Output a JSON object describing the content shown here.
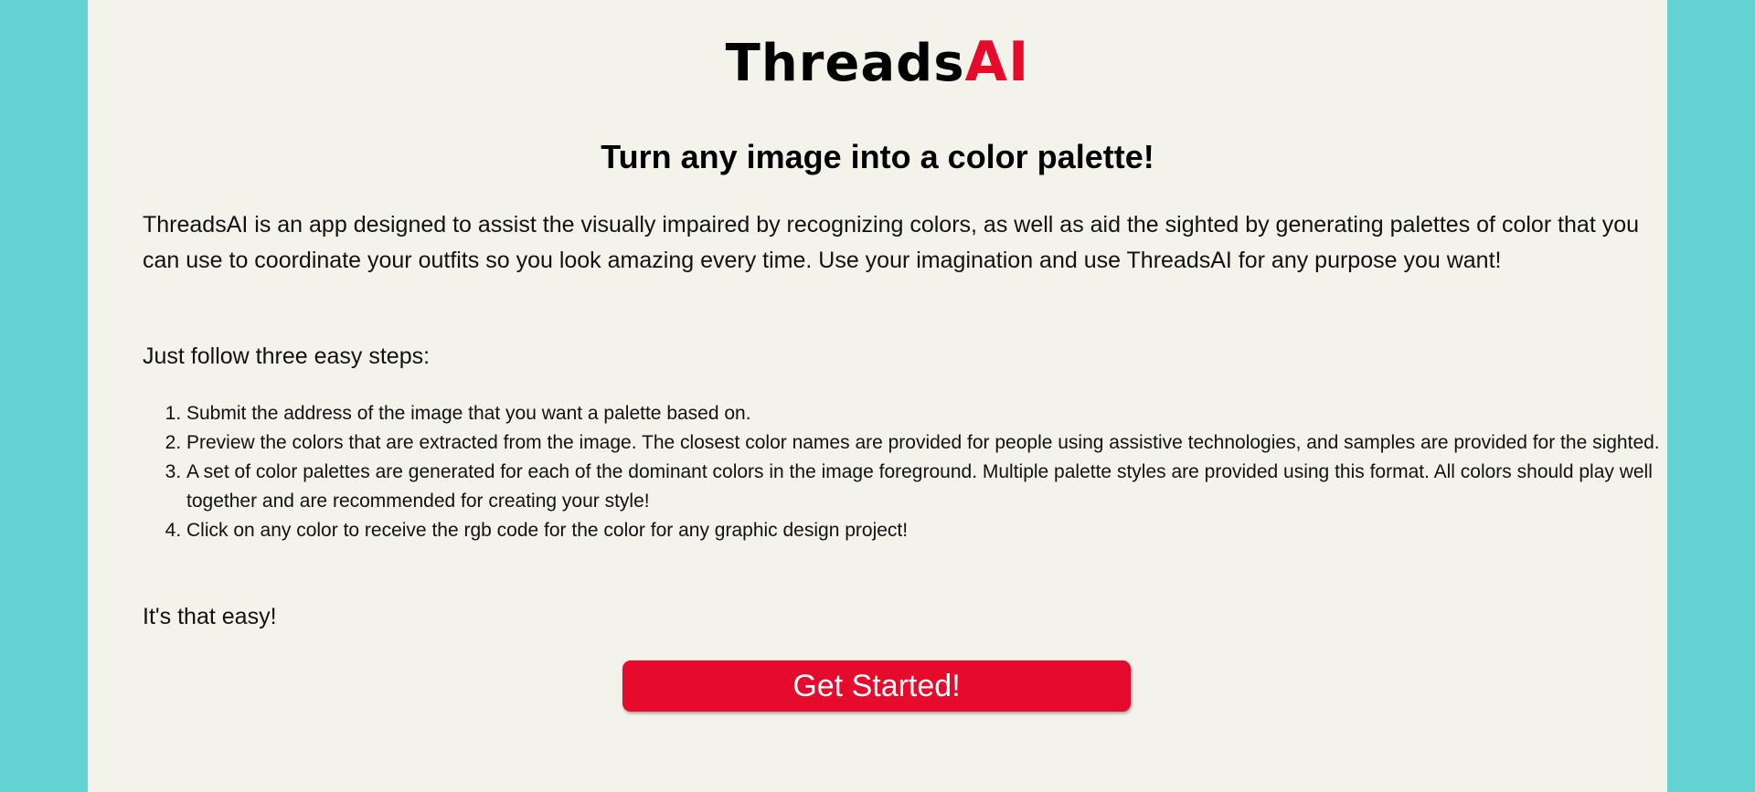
{
  "brand": {
    "name_main": "Threads",
    "name_accent": "AI",
    "colors": {
      "main": "#000000",
      "accent": "#e60a2d",
      "background": "#62d2d3",
      "panel": "#f3f3ec"
    }
  },
  "headline": "Turn any image into a color palette!",
  "intro": "ThreadsAI is an app designed to assist the visually impaired by recognizing colors, as well as aid the sighted by generating palettes of color that you can use to coordinate your outfits so you look amazing every time. Use your imagination and use ThreadsAI for any purpose you want!",
  "steps_lead": "Just follow three easy steps:",
  "steps": [
    "Submit the address of the image that you want a palette based on.",
    "Preview the colors that are extracted from the image. The closest color names are provided for people using assistive technologies, and samples are provided for the sighted.",
    "A set of color palettes are generated for each of the dominant colors in the image foreground. Multiple palette styles are provided using this format. All colors should play well together and are recommended for creating your style!",
    "Click on any color to receive the rgb code for the color for any graphic design project!"
  ],
  "outro": "It's that easy!",
  "cta_label": "Get Started!"
}
